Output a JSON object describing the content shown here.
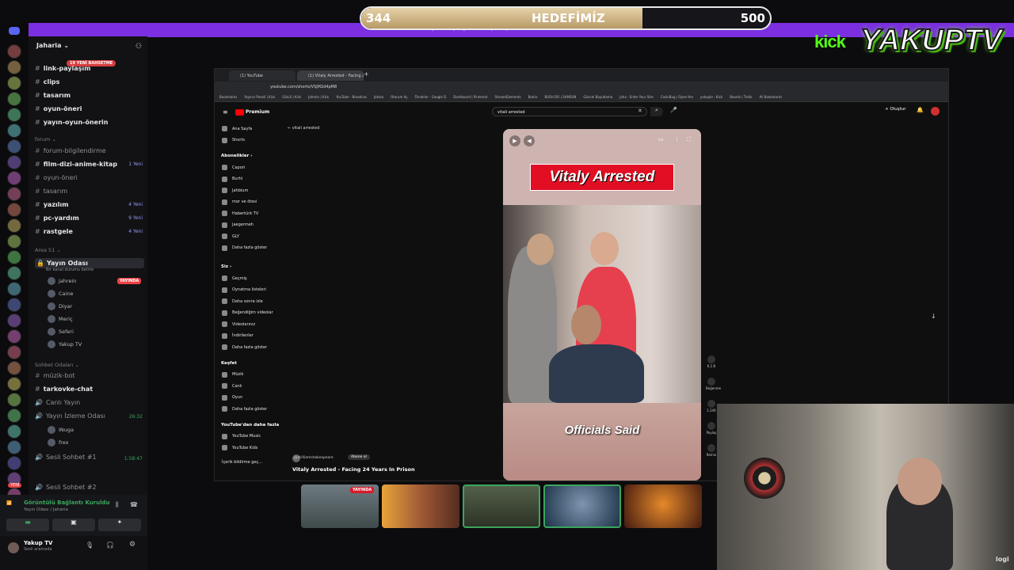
{
  "goal": {
    "current": "344",
    "label": "HEDEFİMİZ",
    "target": "500",
    "progress": 0.688
  },
  "banner_text": "Yayın Hedef Çubuğu — Destek için tıklayın",
  "logo": {
    "kick": "kick",
    "brand": "YAKUPTV"
  },
  "discord": {
    "server_name": "Jaharia",
    "new_badge": "19 YENİ BAHSETME",
    "channels_top": [
      "link-paylaşım",
      "clips",
      "tasarım",
      "oyun-öneri",
      "yayın-oyun-önerin"
    ],
    "forum_category": "forum",
    "forum_channels": [
      {
        "name": "forum-bilgilendirme",
        "unread": ""
      },
      {
        "name": "film-dizi-anime-kitap",
        "unread": "1 Yeni"
      },
      {
        "name": "oyun-öneri",
        "unread": ""
      },
      {
        "name": "tasarım",
        "unread": ""
      },
      {
        "name": "yazılım",
        "unread": "4 Yeni"
      },
      {
        "name": "pc-yardım",
        "unread": "9 Yeni"
      },
      {
        "name": "rastgele",
        "unread": "4 Yeni"
      }
    ],
    "area_category": "Area 51",
    "voice_channel": "Yayın Odası",
    "voice_status": "Bir kanal durumu belirle",
    "live_label": "YAYINDA",
    "voice_users": [
      "jahrein",
      "Caine",
      "Diyar",
      "Meriç",
      "Seferi",
      "Yakup TV"
    ],
    "chat_category": "Sohbet Odaları",
    "chat_channels": [
      "müzik-bot",
      "tarkovke-chat",
      "Canlı Yayın",
      "Yayın İzleme Odası",
      "Sesli Sohbet #1",
      "Sesli Sohbet #2"
    ],
    "watch_users": [
      "INuga",
      "frex"
    ],
    "timer1": "26:32",
    "timer2": "1:58:47",
    "server_new": "YENİ",
    "connection": {
      "status": "Görüntülü Bağlantı Kuruldu",
      "location": "Yayın Odası / Jaharia"
    },
    "user": {
      "name": "Yakup TV",
      "status": "Sesli aramada"
    }
  },
  "browser": {
    "tabs": [
      "(1) YouTube",
      "(1) Vitaly Arrested - Facing 24"
    ],
    "url": "youtube.com/shorts/VSjM2d4pM8",
    "bookmarks": [
      "Bookmarks",
      "Yayıncı Paneli | Kick",
      "Gönül | Kick",
      "Jahrein | Kick",
      "YouTube - Broadcas",
      "Jahaia",
      "Otorum Aç",
      "Örnekler - Google D",
      "Dashboard | Pinterest",
      "StreamElements",
      "Botrix",
      "BUSH DO | SAMSUN",
      "Güncel Boyutlama",
      "Jaha - Enter Your Stre",
      "CasinBug | Open the",
      "yakuptv - Kick",
      "Boards | Trello",
      "All Bookmarks"
    ],
    "yt_brand": "Premium",
    "search_value": "vitali arrested",
    "back_label": "vitali arrested",
    "create_label": "Oluştur",
    "sidebar": {
      "main": [
        "Ana Sayfa",
        "Shorts"
      ],
      "subs_head": "Abonelikler",
      "subs": [
        "Capori",
        "Burhi",
        "Jahbium",
        "mor ve ötesi",
        "Habertürk TV",
        "Jaegermeh",
        "GLY",
        "Daha fazla göster"
      ],
      "you_head": "Siz",
      "you": [
        "Geçmiş",
        "Oynatma listeleri",
        "Daha sonra izle",
        "Beğendiğim videolar",
        "Videolarınız",
        "İndirilenler",
        "Daha fazla göster"
      ],
      "explore_head": "Keşfet",
      "explore": [
        "Müzik",
        "Canlı",
        "Oyun",
        "Daha fazla göster"
      ],
      "more_head": "YouTube'dan daha fazla",
      "more": [
        "YouTube Music",
        "YouTube Kids"
      ],
      "report": "İçerik bildirme geç..."
    },
    "short": {
      "overlay_title": "Vitaly Arrested",
      "caption": "Officials Said",
      "title": "Vitaly Arrested - Facing 24 Years In Prison",
      "channel": "@drilliamshakespeare",
      "subscribe": "Abone ol",
      "likes": "6,1 B",
      "dislike": "Beğenme",
      "comments": "1.240",
      "share": "Paylaş",
      "remix": "Remix"
    }
  },
  "webcam_brand": "logi"
}
